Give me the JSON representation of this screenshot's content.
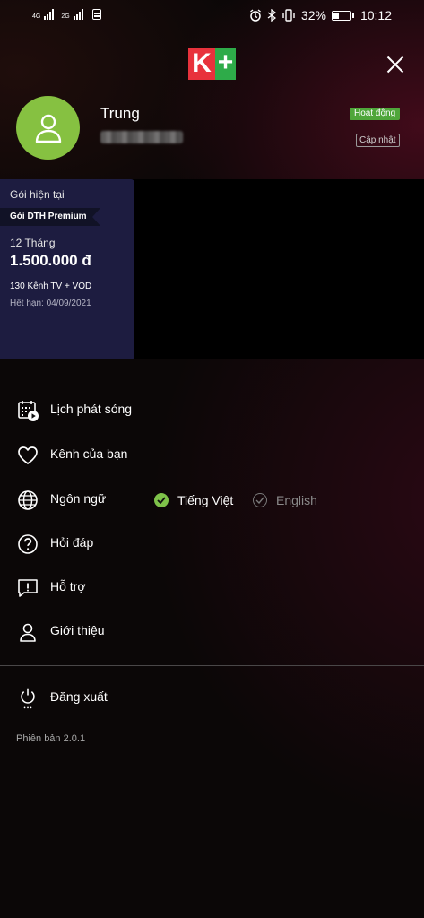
{
  "status_bar": {
    "net1": "4G",
    "net2": "2G",
    "battery": "32%",
    "time": "10:12"
  },
  "header": {
    "logo_k": "K",
    "logo_plus": "+"
  },
  "profile": {
    "name": "Trung",
    "status_badge": "Hoạt động",
    "update_button": "Cập nhật"
  },
  "package": {
    "label": "Gói hiện tại",
    "name": "Gói DTH Premium",
    "term": "12 Tháng",
    "price": "1.500.000 đ",
    "channels": "130 Kênh TV + VOD",
    "expiry": "Hết hạn: 04/09/2021"
  },
  "menu": {
    "schedule": "Lịch phát sóng",
    "my_channels": "Kênh của bạn",
    "language": "Ngôn ngữ",
    "faq": "Hỏi đáp",
    "support": "Hỗ trợ",
    "about": "Giới thiệu",
    "logout": "Đăng xuất"
  },
  "language_options": {
    "vietnamese": "Tiếng Việt",
    "english": "English",
    "selected": "vietnamese"
  },
  "version": "Phiên bản 2.0.1",
  "colors": {
    "accent_green": "#86c141",
    "card_bg": "#1d1c40",
    "logo_red": "#e8323c",
    "logo_green": "#2eab49"
  }
}
